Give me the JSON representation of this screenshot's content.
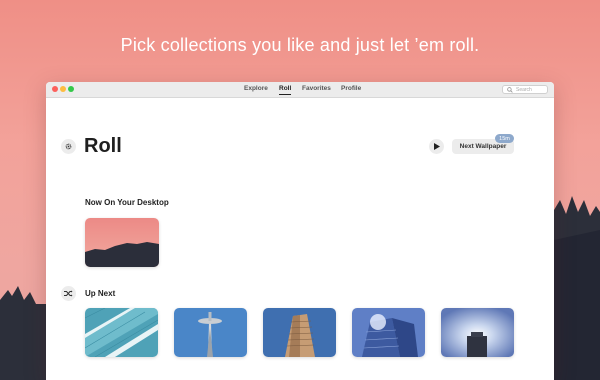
{
  "tagline": "Pick collections you like and just let ’em roll.",
  "nav": {
    "items": [
      {
        "label": "Explore",
        "active": false
      },
      {
        "label": "Roll",
        "active": true
      },
      {
        "label": "Favorites",
        "active": false
      },
      {
        "label": "Profile",
        "active": false
      }
    ],
    "search_placeholder": "Search"
  },
  "page": {
    "title": "Roll",
    "next_wallpaper_label": "Next Wallpaper",
    "timer_badge": "15m"
  },
  "sections": {
    "now_on_desktop": "Now On Your Desktop",
    "up_next": "Up Next"
  },
  "icons": {
    "settings": "gear-icon",
    "play": "play-icon",
    "shuffle": "shuffle-icon",
    "search": "search-icon"
  },
  "colors": {
    "background_top": "#ef8f86",
    "badge": "#8ea9cc"
  }
}
